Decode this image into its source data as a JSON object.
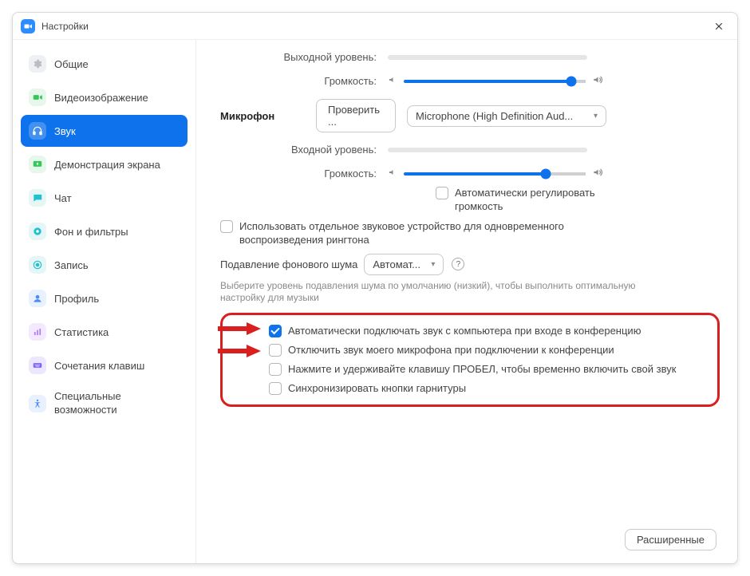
{
  "window": {
    "title": "Настройки"
  },
  "sidebar": {
    "items": [
      {
        "label": "Общие"
      },
      {
        "label": "Видеоизображение"
      },
      {
        "label": "Звук"
      },
      {
        "label": "Демонстрация экрана"
      },
      {
        "label": "Чат"
      },
      {
        "label": "Фон и фильтры"
      },
      {
        "label": "Запись"
      },
      {
        "label": "Профиль"
      },
      {
        "label": "Статистика"
      },
      {
        "label": "Сочетания клавиш"
      },
      {
        "label": "Специальные возможности"
      }
    ]
  },
  "content": {
    "output_level_label": "Выходной уровень:",
    "volume_label": "Громкость:",
    "speaker_slider_percent": 92,
    "microphone_section": "Микрофон",
    "test_button": "Проверить ...",
    "mic_device": "Microphone (High Definition Aud...",
    "input_level_label": "Входной уровень:",
    "mic_slider_percent": 78,
    "auto_volume_label": "Автоматически регулировать громкость",
    "ringtone_label": "Использовать отдельное звуковое устройство для одновременного воспроизведения рингтона",
    "noise_suppress_label": "Подавление фонового шума",
    "noise_suppress_value": "Автомат...",
    "noise_help": "?",
    "noise_hint": "Выберите уровень подавления шума по умолчанию (низкий), чтобы выполнить оптимальную настройку для музыки",
    "check_auto_join": "Автоматически подключать звук с компьютера при входе в конференцию",
    "check_mute_on_join": "Отключить звук моего микрофона при подключении к конференции",
    "check_push_to_talk": "Нажмите и удерживайте клавишу ПРОБЕЛ, чтобы временно включить свой звук",
    "check_sync_headset": "Синхронизировать кнопки гарнитуры",
    "advanced_button": "Расширенные"
  },
  "colors": {
    "accent": "#0E72ED",
    "highlight": "#DB1F1F"
  }
}
